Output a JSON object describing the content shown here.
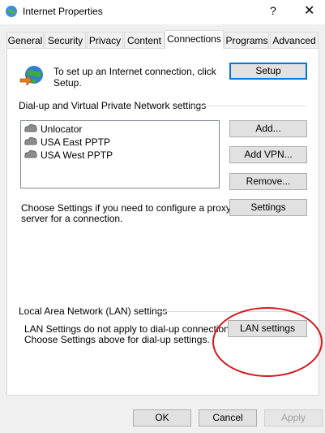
{
  "window": {
    "title": "Internet Properties",
    "help_glyph": "?",
    "close_glyph": "✕"
  },
  "tabs": [
    {
      "label": "General",
      "active": false
    },
    {
      "label": "Security",
      "active": false
    },
    {
      "label": "Privacy",
      "active": false
    },
    {
      "label": "Content",
      "active": false
    },
    {
      "label": "Connections",
      "active": true
    },
    {
      "label": "Programs",
      "active": false
    },
    {
      "label": "Advanced",
      "active": false
    }
  ],
  "setup": {
    "text_line1": "To set up an Internet connection, click",
    "text_line2": "Setup.",
    "button": "Setup",
    "icon": "globe-connection-icon"
  },
  "vpn": {
    "group_label": "Dial-up and Virtual Private Network settings",
    "connections": [
      {
        "name": "Unlocator"
      },
      {
        "name": "USA East PPTP"
      },
      {
        "name": "USA West PPTP"
      }
    ],
    "add_button": "Add...",
    "add_vpn_button": "Add VPN...",
    "remove_button": "Remove...",
    "proxy_text_line1": "Choose Settings if you need to configure a proxy",
    "proxy_text_line2": "server for a connection.",
    "settings_button": "Settings"
  },
  "lan": {
    "group_label": "Local Area Network (LAN) settings",
    "text_line1": "LAN Settings do not apply to dial-up connections.",
    "text_line2": "Choose Settings above for dial-up settings.",
    "button": "LAN settings",
    "annotation_color": "#d3161a"
  },
  "footer": {
    "ok": "OK",
    "cancel": "Cancel",
    "apply": "Apply"
  },
  "colors": {
    "accent": "#0078d7",
    "annotation": "#d3161a"
  }
}
